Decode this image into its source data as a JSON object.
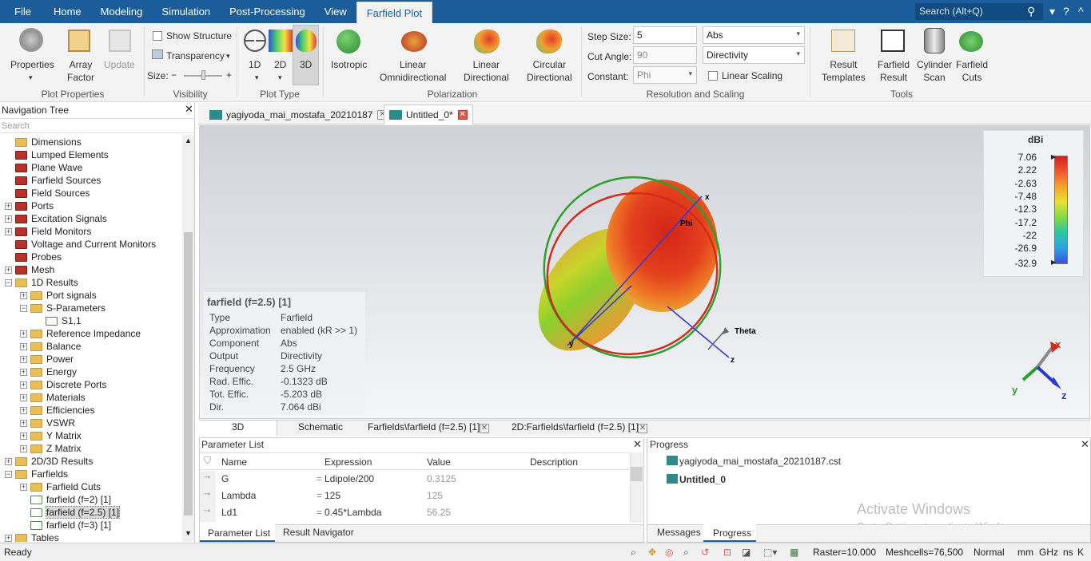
{
  "menu": {
    "items": [
      "File",
      "Home",
      "Modeling",
      "Simulation",
      "Post-Processing",
      "View",
      "Farfield Plot"
    ],
    "search_placeholder": "Search (Alt+Q)"
  },
  "ribbon": {
    "plot_properties": {
      "properties": "Properties",
      "array_factor": "Array\nFactor",
      "update": "Update",
      "group": "Plot Properties"
    },
    "visibility": {
      "show_structure": "Show Structure",
      "transparency": "Transparency",
      "size": "Size:",
      "group": "Visibility"
    },
    "plot_type": {
      "d1": "1D",
      "d2": "2D",
      "d3": "3D",
      "group": "Plot Type"
    },
    "polarization": {
      "isotropic": "Isotropic",
      "linear_omni": "Linear\nOmnidirectional",
      "linear_dir": "Linear\nDirectional",
      "circular_dir": "Circular\nDirectional",
      "group": "Polarization"
    },
    "resolution": {
      "step_size_label": "Step Size:",
      "step_size": "5",
      "cut_angle_label": "Cut Angle:",
      "cut_angle": "90",
      "constant_label": "Constant:",
      "constant": "Phi",
      "component": "Abs",
      "output": "Directivity",
      "linear_scaling": "Linear Scaling",
      "group": "Resolution and Scaling"
    },
    "tools": {
      "result_templates": "Result\nTemplates",
      "farfield_result": "Farfield\nResult",
      "cylinder_scan": "Cylinder\nScan",
      "farfield_cuts": "Farfield\nCuts",
      "group": "Tools"
    }
  },
  "nav": {
    "title": "Navigation Tree",
    "search": "Search",
    "items": [
      {
        "label": "Dimensions",
        "indent": 1,
        "icon": "fold",
        "exp": ""
      },
      {
        "label": "Lumped Elements",
        "indent": 1,
        "icon": "fred",
        "exp": ""
      },
      {
        "label": "Plane Wave",
        "indent": 1,
        "icon": "fred",
        "exp": ""
      },
      {
        "label": "Farfield Sources",
        "indent": 1,
        "icon": "fred",
        "exp": ""
      },
      {
        "label": "Field Sources",
        "indent": 1,
        "icon": "fred",
        "exp": ""
      },
      {
        "label": "Ports",
        "indent": 1,
        "icon": "fred",
        "exp": "+"
      },
      {
        "label": "Excitation Signals",
        "indent": 1,
        "icon": "fred",
        "exp": "+"
      },
      {
        "label": "Field Monitors",
        "indent": 1,
        "icon": "fred",
        "exp": "+"
      },
      {
        "label": "Voltage and Current Monitors",
        "indent": 1,
        "icon": "fred",
        "exp": ""
      },
      {
        "label": "Probes",
        "indent": 1,
        "icon": "fred",
        "exp": ""
      },
      {
        "label": "Mesh",
        "indent": 1,
        "icon": "fred",
        "exp": "+"
      },
      {
        "label": "1D Results",
        "indent": 1,
        "icon": "fold",
        "exp": "-"
      },
      {
        "label": "Port signals",
        "indent": 2,
        "icon": "fold",
        "exp": "+"
      },
      {
        "label": "S-Parameters",
        "indent": 2,
        "icon": "fold",
        "exp": "-"
      },
      {
        "label": "S1,1",
        "indent": 3,
        "icon": "fline",
        "exp": ""
      },
      {
        "label": "Reference Impedance",
        "indent": 2,
        "icon": "fold",
        "exp": "+"
      },
      {
        "label": "Balance",
        "indent": 2,
        "icon": "fold",
        "exp": "+"
      },
      {
        "label": "Power",
        "indent": 2,
        "icon": "fold",
        "exp": "+"
      },
      {
        "label": "Energy",
        "indent": 2,
        "icon": "fold",
        "exp": "+"
      },
      {
        "label": "Discrete Ports",
        "indent": 2,
        "icon": "fold",
        "exp": "+"
      },
      {
        "label": "Materials",
        "indent": 2,
        "icon": "fold",
        "exp": "+"
      },
      {
        "label": "Efficiencies",
        "indent": 2,
        "icon": "fold",
        "exp": "+"
      },
      {
        "label": "VSWR",
        "indent": 2,
        "icon": "fold",
        "exp": "+"
      },
      {
        "label": "Y Matrix",
        "indent": 2,
        "icon": "fold",
        "exp": "+"
      },
      {
        "label": "Z Matrix",
        "indent": 2,
        "icon": "fold",
        "exp": "+"
      },
      {
        "label": "2D/3D Results",
        "indent": 1,
        "icon": "fold",
        "exp": "+"
      },
      {
        "label": "Farfields",
        "indent": 1,
        "icon": "fold",
        "exp": "-"
      },
      {
        "label": "Farfield Cuts",
        "indent": 2,
        "icon": "fold",
        "exp": "+"
      },
      {
        "label": "farfield (f=2) [1]",
        "indent": 2,
        "icon": "fline",
        "exp": ""
      },
      {
        "label": "farfield (f=2.5) [1]",
        "indent": 2,
        "icon": "fline",
        "exp": "",
        "selected": true
      },
      {
        "label": "farfield (f=3) [1]",
        "indent": 2,
        "icon": "fline",
        "exp": ""
      },
      {
        "label": "Tables",
        "indent": 1,
        "icon": "fold",
        "exp": "+"
      }
    ]
  },
  "tabs": {
    "tab1": "yagiyoda_mai_mostafa_20210187",
    "tab2": "Untitled_0*"
  },
  "view": {
    "axis_x": "x",
    "axis_y": "y",
    "axis_z": "z",
    "phi": "Phi",
    "theta": "Theta",
    "legend": {
      "unit": "dBi",
      "values": [
        "7.06",
        "2.22",
        "-2.63",
        "-7.48",
        "-12.3",
        "-17.2",
        "-22",
        "-26.9",
        "-32.9"
      ]
    },
    "info": {
      "title": "farfield (f=2.5) [1]",
      "rows": [
        [
          "Type",
          "Farfield"
        ],
        [
          "Approximation",
          "enabled (kR >> 1)"
        ],
        [
          "Component",
          "Abs"
        ],
        [
          "Output",
          "Directivity"
        ],
        [
          "Frequency",
          "2.5 GHz"
        ],
        [
          "Rad. Effic.",
          "-0.1323 dB"
        ],
        [
          "Tot. Effic.",
          "-5.203 dB"
        ],
        [
          "Dir.",
          "7.064 dBi"
        ]
      ]
    }
  },
  "bottom_tabs": [
    "3D",
    "Schematic",
    "Farfields\\farfield (f=2.5) [1]",
    "2D:Farfields\\farfield (f=2.5) [1]"
  ],
  "params": {
    "title": "Parameter List",
    "headers": [
      "Name",
      "Expression",
      "Value",
      "Description"
    ],
    "rows": [
      [
        "G",
        "Ldipole/200",
        "0.3125",
        ""
      ],
      [
        "Lambda",
        "125",
        "125",
        ""
      ],
      [
        "Ld1",
        "0.45*Lambda",
        "56.25",
        ""
      ]
    ],
    "tabs": [
      "Parameter List",
      "Result Navigator"
    ]
  },
  "progress": {
    "title": "Progress",
    "items": [
      "yagiyoda_mai_mostafa_20210187.cst",
      "Untitled_0"
    ],
    "tabs": [
      "Messages",
      "Progress"
    ],
    "watermark1": "Activate Windows",
    "watermark2": "Go to Settings to activate Windows."
  },
  "status": {
    "ready": "Ready",
    "raster": "Raster=10.000",
    "meshcells": "Meshcells=76,500",
    "mode": "Normal",
    "units": [
      "mm",
      "GHz",
      "ns",
      "K"
    ]
  },
  "colors": {
    "accent": "#1b5d9b"
  }
}
